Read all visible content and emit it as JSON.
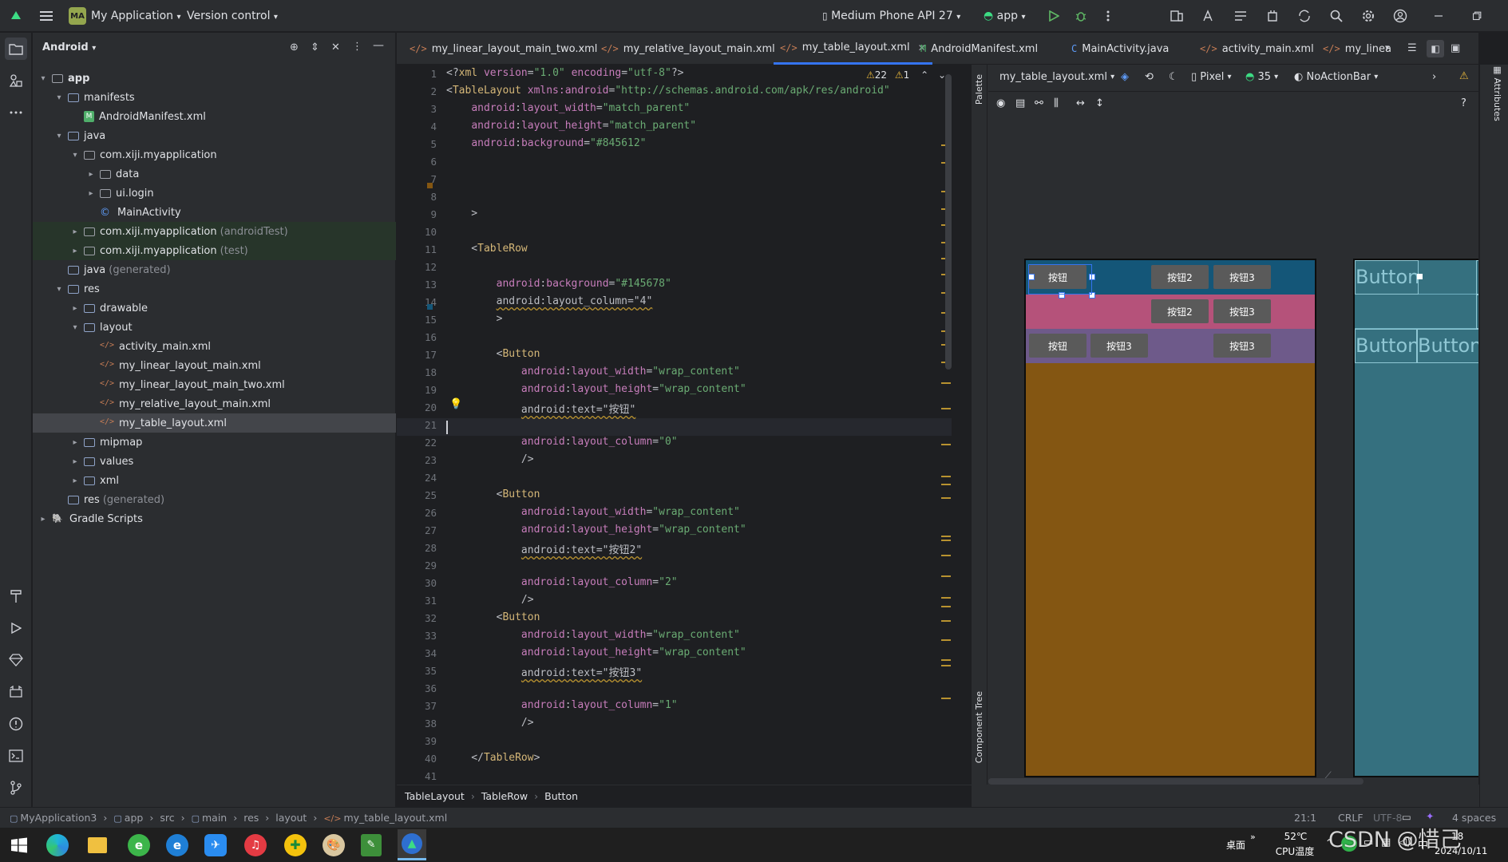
{
  "titlebar": {
    "project_badge": "MA",
    "project_name": "My Application",
    "vcs": "Version control",
    "device": "Medium Phone API 27",
    "run_config": "app"
  },
  "project_panel": {
    "title": "Android",
    "tree": [
      {
        "label": "app",
        "depth": 0,
        "icon": "module-folder-icon",
        "chev": "▾"
      },
      {
        "label": "manifests",
        "depth": 1,
        "icon": "folder-icon",
        "chev": "▾"
      },
      {
        "label": "AndroidManifest.xml",
        "depth": 2,
        "icon": "manifest-icon",
        "chev": ""
      },
      {
        "label": "java",
        "depth": 1,
        "icon": "folder-icon",
        "chev": "▾"
      },
      {
        "label": "com.xiji.myapplication",
        "depth": 2,
        "icon": "package-icon",
        "chev": "▾"
      },
      {
        "label": "data",
        "depth": 3,
        "icon": "package-icon",
        "chev": "▸"
      },
      {
        "label": "ui.login",
        "depth": 3,
        "icon": "package-icon",
        "chev": "▸"
      },
      {
        "label": "MainActivity",
        "depth": 3,
        "icon": "class-icon",
        "chev": ""
      },
      {
        "label": "com.xiji.myapplication",
        "suffix": "(androidTest)",
        "depth": 2,
        "icon": "package-icon",
        "chev": "▸",
        "green": true
      },
      {
        "label": "com.xiji.myapplication",
        "suffix": "(test)",
        "depth": 2,
        "icon": "package-icon",
        "chev": "▸",
        "green": true
      },
      {
        "label": "java",
        "suffix": "(generated)",
        "depth": 1,
        "icon": "folder-icon",
        "chev": ""
      },
      {
        "label": "res",
        "depth": 1,
        "icon": "folder-icon",
        "chev": "▾"
      },
      {
        "label": "drawable",
        "depth": 2,
        "icon": "folder-icon",
        "chev": "▸"
      },
      {
        "label": "layout",
        "depth": 2,
        "icon": "folder-icon",
        "chev": "▾"
      },
      {
        "label": "activity_main.xml",
        "depth": 3,
        "icon": "xml-icon",
        "chev": ""
      },
      {
        "label": "my_linear_layout_main.xml",
        "depth": 3,
        "icon": "xml-icon",
        "chev": ""
      },
      {
        "label": "my_linear_layout_main_two.xml",
        "depth": 3,
        "icon": "xml-icon",
        "chev": ""
      },
      {
        "label": "my_relative_layout_main.xml",
        "depth": 3,
        "icon": "xml-icon",
        "chev": ""
      },
      {
        "label": "my_table_layout.xml",
        "depth": 3,
        "icon": "xml-icon",
        "chev": "",
        "selected": true
      },
      {
        "label": "mipmap",
        "depth": 2,
        "icon": "folder-icon",
        "chev": "▸"
      },
      {
        "label": "values",
        "depth": 2,
        "icon": "folder-icon",
        "chev": "▸"
      },
      {
        "label": "xml",
        "depth": 2,
        "icon": "folder-icon",
        "chev": "▸"
      },
      {
        "label": "res",
        "suffix": "(generated)",
        "depth": 1,
        "icon": "folder-icon",
        "chev": ""
      },
      {
        "label": "Gradle Scripts",
        "depth": 0,
        "icon": "gradle-icon",
        "chev": "▸"
      }
    ]
  },
  "tabs": [
    {
      "label": "my_linear_layout_main_two.xml",
      "icon": "</>"
    },
    {
      "label": "my_relative_layout_main.xml",
      "icon": "</>"
    },
    {
      "label": "my_table_layout.xml",
      "icon": "</>",
      "active": true
    },
    {
      "label": "AndroidManifest.xml",
      "icon": "M"
    },
    {
      "label": "MainActivity.java",
      "icon": "C"
    },
    {
      "label": "activity_main.xml",
      "icon": "</>"
    },
    {
      "label": "my_linear",
      "icon": "</>"
    }
  ],
  "inspection": {
    "warnings": "22",
    "weak": "1"
  },
  "code_lines": [
    [
      [
        "pn",
        "<?"
      ],
      [
        "tg",
        "xml "
      ],
      [
        "at",
        "version"
      ],
      [
        "pn",
        "="
      ],
      [
        "vl",
        "\"1.0\""
      ],
      [
        "pn",
        " "
      ],
      [
        "at",
        "encoding"
      ],
      [
        "pn",
        "="
      ],
      [
        "vl",
        "\"utf-8\""
      ],
      [
        "pn",
        "?>"
      ]
    ],
    [
      [
        "pn",
        "<"
      ],
      [
        "tg",
        "TableLayout "
      ],
      [
        "ns",
        "xmlns:android"
      ],
      [
        "pn",
        "="
      ],
      [
        "vl",
        "\"http://schemas.android.com/apk/res/android\""
      ]
    ],
    [
      [
        "pn",
        "    "
      ],
      [
        "ns",
        "android"
      ],
      [
        "pn",
        ":"
      ],
      [
        "at",
        "layout_width"
      ],
      [
        "pn",
        "="
      ],
      [
        "vl",
        "\"match_parent\""
      ]
    ],
    [
      [
        "pn",
        "    "
      ],
      [
        "ns",
        "android"
      ],
      [
        "pn",
        ":"
      ],
      [
        "at",
        "layout_height"
      ],
      [
        "pn",
        "="
      ],
      [
        "vl",
        "\"match_parent\""
      ]
    ],
    [
      [
        "pn",
        "    "
      ],
      [
        "ns",
        "android"
      ],
      [
        "pn",
        ":"
      ],
      [
        "at",
        "background"
      ],
      [
        "pn",
        "="
      ],
      [
        "vl",
        "\"#845612\""
      ]
    ],
    [],
    [],
    [],
    [
      [
        "pn",
        "    >"
      ]
    ],
    [],
    [
      [
        "pn",
        "    <"
      ],
      [
        "tg",
        "TableRow"
      ]
    ],
    [],
    [
      [
        "pn",
        "        "
      ],
      [
        "ns",
        "android"
      ],
      [
        "pn",
        ":"
      ],
      [
        "at",
        "background"
      ],
      [
        "pn",
        "="
      ],
      [
        "vl",
        "\"#145678\""
      ]
    ],
    [
      [
        "pn",
        "        "
      ],
      [
        "ul",
        "android:layout_column=\"4\""
      ]
    ],
    [
      [
        "pn",
        "        >"
      ]
    ],
    [],
    [
      [
        "pn",
        "        <"
      ],
      [
        "tg",
        "Button"
      ]
    ],
    [
      [
        "pn",
        "            "
      ],
      [
        "ns",
        "android"
      ],
      [
        "pn",
        ":"
      ],
      [
        "at",
        "layout_width"
      ],
      [
        "pn",
        "="
      ],
      [
        "vl",
        "\"wrap_content\""
      ]
    ],
    [
      [
        "pn",
        "            "
      ],
      [
        "ns",
        "android"
      ],
      [
        "pn",
        ":"
      ],
      [
        "at",
        "layout_height"
      ],
      [
        "pn",
        "="
      ],
      [
        "vl",
        "\"wrap_content\""
      ]
    ],
    [
      [
        "pn",
        "            "
      ],
      [
        "ul",
        "android:text=\"按钮\""
      ]
    ],
    [],
    [
      [
        "pn",
        "            "
      ],
      [
        "ns",
        "android"
      ],
      [
        "pn",
        ":"
      ],
      [
        "at",
        "layout_column"
      ],
      [
        "pn",
        "="
      ],
      [
        "vl",
        "\"0\""
      ]
    ],
    [
      [
        "pn",
        "            />"
      ]
    ],
    [],
    [
      [
        "pn",
        "        <"
      ],
      [
        "tg",
        "Button"
      ]
    ],
    [
      [
        "pn",
        "            "
      ],
      [
        "ns",
        "android"
      ],
      [
        "pn",
        ":"
      ],
      [
        "at",
        "layout_width"
      ],
      [
        "pn",
        "="
      ],
      [
        "vl",
        "\"wrap_content\""
      ]
    ],
    [
      [
        "pn",
        "            "
      ],
      [
        "ns",
        "android"
      ],
      [
        "pn",
        ":"
      ],
      [
        "at",
        "layout_height"
      ],
      [
        "pn",
        "="
      ],
      [
        "vl",
        "\"wrap_content\""
      ]
    ],
    [
      [
        "pn",
        "            "
      ],
      [
        "ul",
        "android:text=\"按钮2\""
      ]
    ],
    [],
    [
      [
        "pn",
        "            "
      ],
      [
        "ns",
        "android"
      ],
      [
        "pn",
        ":"
      ],
      [
        "at",
        "layout_column"
      ],
      [
        "pn",
        "="
      ],
      [
        "vl",
        "\"2\""
      ]
    ],
    [
      [
        "pn",
        "            />"
      ]
    ],
    [
      [
        "pn",
        "        <"
      ],
      [
        "tg",
        "Button"
      ]
    ],
    [
      [
        "pn",
        "            "
      ],
      [
        "ns",
        "android"
      ],
      [
        "pn",
        ":"
      ],
      [
        "at",
        "layout_width"
      ],
      [
        "pn",
        "="
      ],
      [
        "vl",
        "\"wrap_content\""
      ]
    ],
    [
      [
        "pn",
        "            "
      ],
      [
        "ns",
        "android"
      ],
      [
        "pn",
        ":"
      ],
      [
        "at",
        "layout_height"
      ],
      [
        "pn",
        "="
      ],
      [
        "vl",
        "\"wrap_content\""
      ]
    ],
    [
      [
        "pn",
        "            "
      ],
      [
        "ul",
        "android:text=\"按钮3\""
      ]
    ],
    [],
    [
      [
        "pn",
        "            "
      ],
      [
        "ns",
        "android"
      ],
      [
        "pn",
        ":"
      ],
      [
        "at",
        "layout_column"
      ],
      [
        "pn",
        "="
      ],
      [
        "vl",
        "\"1\""
      ]
    ],
    [
      [
        "pn",
        "            />"
      ]
    ],
    [],
    [
      [
        "pn",
        "    </"
      ],
      [
        "tg",
        "TableRow"
      ],
      [
        "pn",
        ">"
      ]
    ],
    []
  ],
  "design": {
    "file": "my_table_layout.xml",
    "device": "Pixel",
    "api": "35",
    "theme": "NoActionBar",
    "palette": "Palette",
    "component_tree": "Component Tree",
    "attributes": "Attributes",
    "layout_bg": "#845612",
    "row1_bg": "#145678",
    "row2_bg": "#b5527a",
    "row3_bg": "#6e5a8a",
    "rows": [
      {
        "buttons": [
          "按钮",
          "按钮2",
          "按钮3"
        ]
      },
      {
        "buttons": [
          "按钮2",
          "按钮3"
        ]
      },
      {
        "buttons": [
          "按钮",
          "按钮3",
          "按钮3"
        ]
      }
    ],
    "blueprint": {
      "b1": "Button",
      "b2": "B",
      "b3": "B",
      "b4": "Button",
      "b5": "Button"
    }
  },
  "breadcrumb": [
    "TableLayout",
    "TableRow",
    "Button"
  ],
  "status": {
    "path": [
      "MyApplication3",
      "app",
      "src",
      "main",
      "res",
      "layout",
      "my_table_layout.xml"
    ],
    "position": "21:1",
    "line_sep": "CRLF",
    "encoding": "UTF-8",
    "indent": "4 spaces"
  },
  "taskbar": {
    "desktop": "桌面",
    "temp": "52℃",
    "temp_label": "CPU温度",
    "date": "2024/10/11",
    "time": "18",
    "watermark": "CSDN @惜己"
  }
}
